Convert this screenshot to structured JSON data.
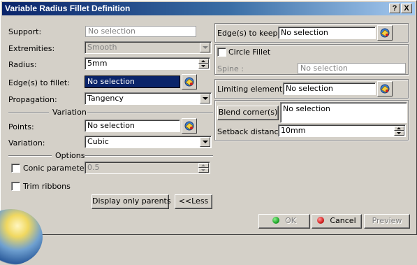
{
  "window": {
    "title": "Variable Radius Fillet Definition"
  },
  "title_buttons": {
    "help": "?",
    "close": "X"
  },
  "left": {
    "support_label": "Support:",
    "support_value": "No selection",
    "extremities_label": "Extremities:",
    "extremities_value": "Smooth",
    "radius_label": "Radius:",
    "radius_value": "5mm",
    "edges_label": "Edge(s) to fillet:",
    "edges_value": "No selection",
    "propagation_label": "Propagation:",
    "propagation_value": "Tangency",
    "variation_section": "Variation",
    "points_label": "Points:",
    "points_value": "No selection",
    "variation_label": "Variation:",
    "variation_value": "Cubic",
    "options_section": "Options",
    "conic_label": "Conic parameter:",
    "conic_value": "0.5",
    "trim_label": "Trim ribbons"
  },
  "right": {
    "edges_keep_label": "Edge(s) to keep:",
    "edges_keep_value": "No selection",
    "circle_fillet_label": "Circle Fillet",
    "spine_label": "Spine :",
    "spine_value": "No selection",
    "limiting_label": "Limiting element(s):",
    "limiting_value": "No selection",
    "blend_button": "Blend corner(s)",
    "blend_value": "No selection",
    "setback_label": "Setback distance:",
    "setback_value": "10mm"
  },
  "buttons": {
    "display_parents": "Display only parents",
    "less": "<<Less",
    "ok": "OK",
    "cancel": "Cancel",
    "preview": "Preview"
  },
  "icons": {
    "selector": "multi-selection-icon",
    "ok_dot": "green-dot-icon",
    "cancel_dot": "red-dot-icon"
  },
  "colors": {
    "title_start": "#0a246a",
    "title_end": "#a6caf0",
    "dialog_bg": "#d4d0c8",
    "selected_field": "#0a246a",
    "ok_green": "#1fa82a",
    "cancel_red": "#d42020"
  }
}
